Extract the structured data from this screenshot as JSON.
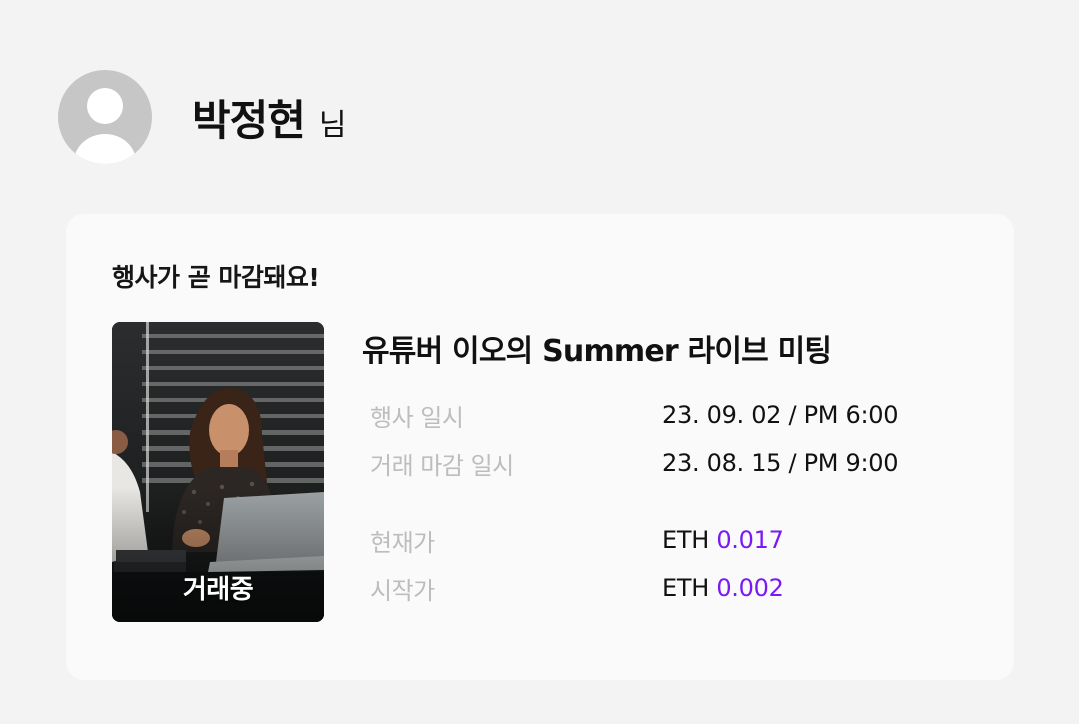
{
  "user": {
    "name": "박정현",
    "suffix": "님"
  },
  "card": {
    "heading": "행사가 곧 마감돼요!",
    "event": {
      "title": "유튜버 이오의 Summer 라이브 미팅",
      "status_badge": "거래중",
      "details": [
        {
          "label": "행사 일시",
          "value": "23. 09. 02 / PM 6:00"
        },
        {
          "label": "거래 마감 일시",
          "value": "23. 08. 15 / PM 9:00"
        }
      ],
      "prices": [
        {
          "label": "현재가",
          "currency": "ETH",
          "amount": "0.017"
        },
        {
          "label": "시작가",
          "currency": "ETH",
          "amount": "0.002"
        }
      ]
    }
  },
  "colors": {
    "accent": "#7b18f5",
    "label_gray": "#bdbdbd",
    "background": "#f3f3f3",
    "card_background": "#fafafa"
  },
  "icons": {
    "avatar": "user-avatar-icon"
  }
}
